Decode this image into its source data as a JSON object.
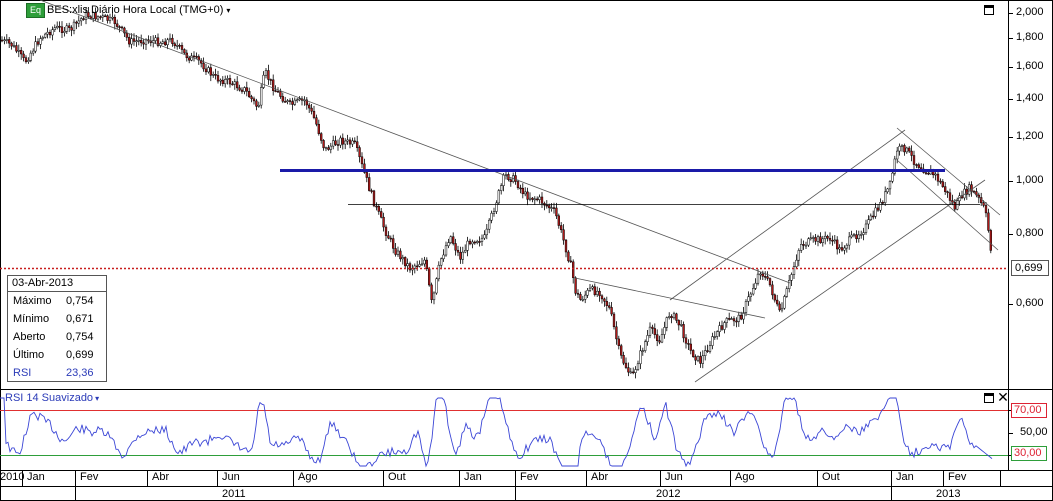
{
  "header": {
    "badge": "Eq",
    "title": "BES:xlis Diário Hora Local (TMG+0)",
    "caret": "▾"
  },
  "icons": {
    "maximize_main": "maximize-icon",
    "maximize_rsi": "maximize-icon",
    "close_rsi": "close-icon"
  },
  "rsi_panel": {
    "title": "RSI 14 Suavizado",
    "caret": "▾",
    "level_high": "70,00",
    "level_mid": "50,00",
    "level_low": "30,00",
    "current": "30,00"
  },
  "info_box": {
    "date": "03-Abr-2013",
    "rows": [
      {
        "label": "Máximo",
        "value": "0,754"
      },
      {
        "label": "Mínimo",
        "value": "0,671"
      },
      {
        "label": "Aberto",
        "value": "0,754"
      },
      {
        "label": "Último",
        "value": "0,699"
      },
      {
        "label": "RSI",
        "value": "23,36"
      }
    ]
  },
  "price_axis": {
    "labels": [
      "2,000",
      "1,800",
      "1,600",
      "1,400",
      "1,200",
      "1,000",
      "0,800",
      "0,600"
    ],
    "last_price": "0,699"
  },
  "time_axis": {
    "months": [
      "2010",
      "Jan",
      "Fev",
      "Abr",
      "Jun",
      "Ago",
      "Out",
      "Jan",
      "Fev",
      "Abr",
      "Jun",
      "Ago",
      "Out",
      "Jan",
      "Fev"
    ],
    "years": [
      "2011",
      "2012",
      "2013"
    ]
  },
  "colors": {
    "resistance_line": "#1a1aa8",
    "last_price_line": "#c81e1e",
    "rsi_line": "#3b46d6",
    "rsi_high_line": "#e03030",
    "rsi_low_line": "#2e9e3a",
    "bull_candle": "#ffffff",
    "bear_candle": "#b01818"
  },
  "chart_data": {
    "type": "candlestick",
    "symbol": "BES:xlis",
    "interval": "Diário",
    "x_range": [
      "2010-12",
      "2013-04-03"
    ],
    "y_scale": "log",
    "ylim": [
      0.5,
      2.1
    ],
    "y_ticks": [
      2.0,
      1.8,
      1.6,
      1.4,
      1.2,
      1.0,
      0.8,
      0.6
    ],
    "last": 0.699,
    "horizontal_lines": [
      {
        "price": 1.05,
        "color": "#1a1aa8",
        "style": "solid-thick"
      },
      {
        "price": 0.91,
        "color": "#000000",
        "style": "solid-thin"
      },
      {
        "price": 0.699,
        "color": "#c81e1e",
        "style": "dotted"
      }
    ],
    "rsi": {
      "period": 14,
      "levels": [
        70,
        50,
        30
      ],
      "current": 23.36,
      "ylim": [
        10,
        90
      ]
    }
  }
}
